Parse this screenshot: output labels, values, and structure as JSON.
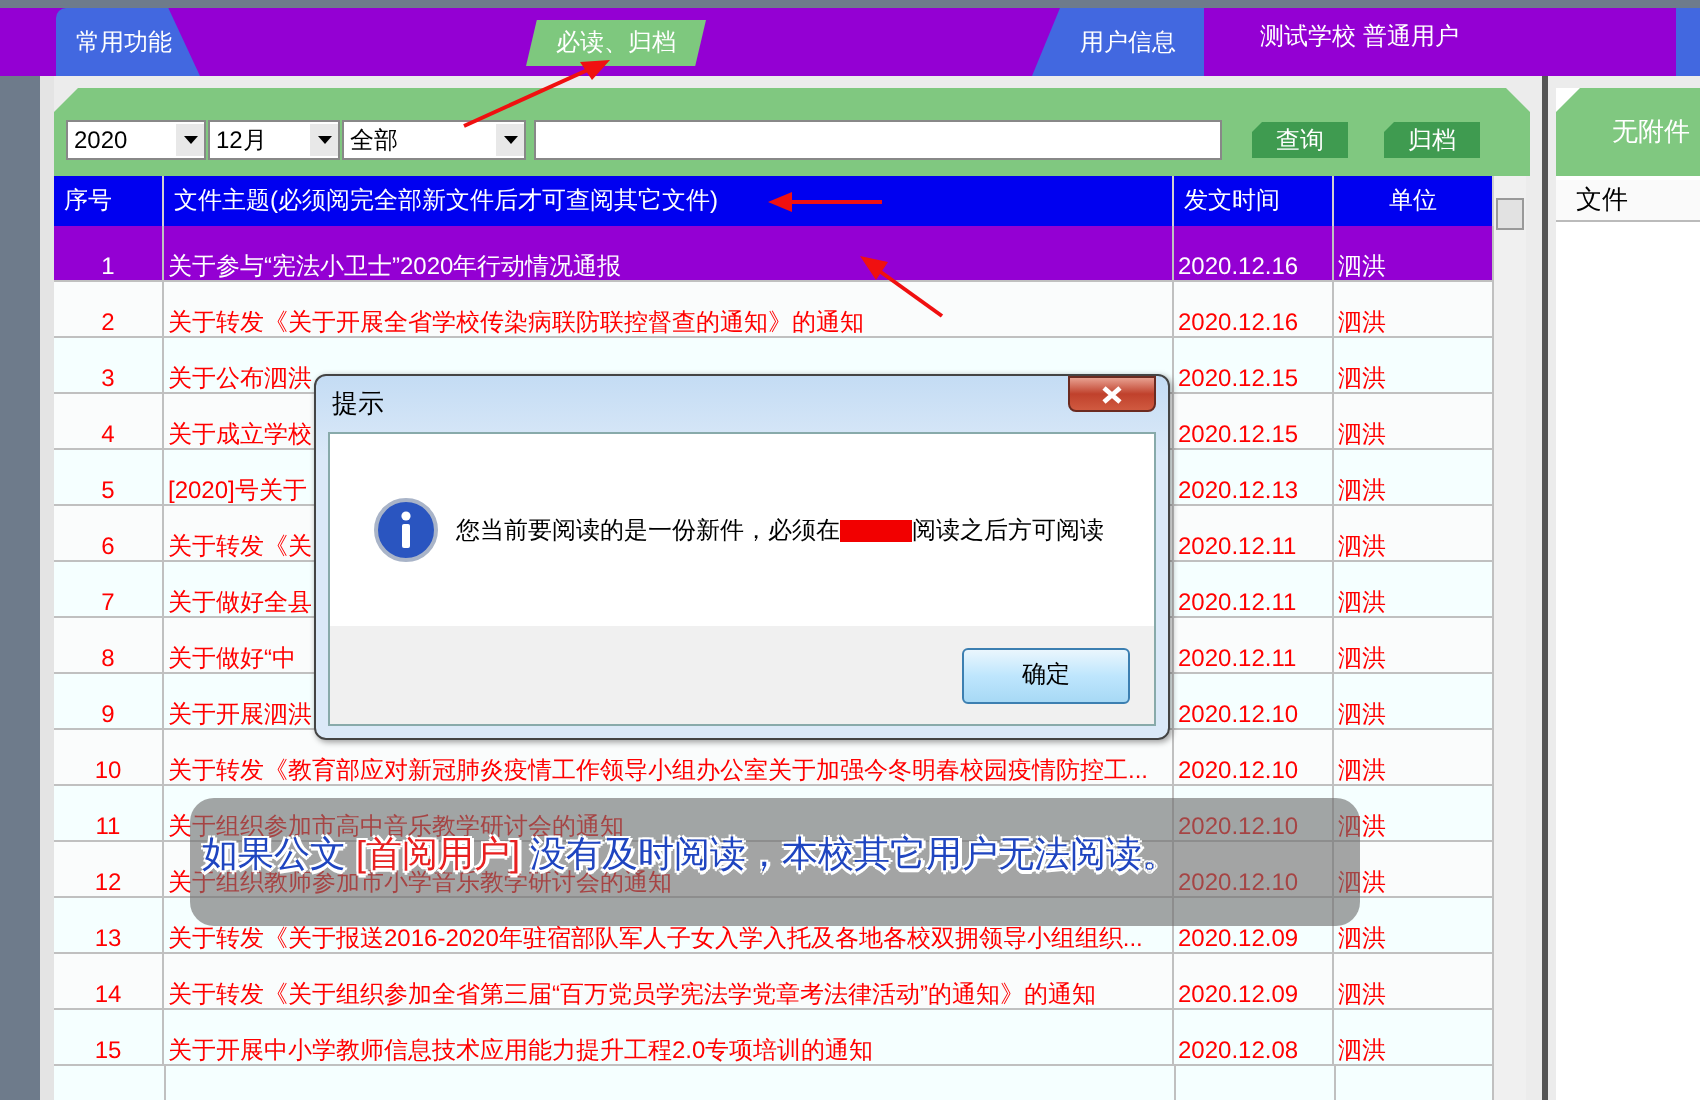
{
  "top_bar": {
    "items": [
      {
        "label": "常用功能",
        "kind": "menu"
      },
      {
        "label": "必读、归档",
        "kind": "current"
      },
      {
        "label": "用户信息",
        "kind": "info"
      },
      {
        "label": "测试学校 普通用户",
        "kind": "user"
      }
    ]
  },
  "filters": [
    {
      "value": "2020"
    },
    {
      "value": "12月"
    },
    {
      "value": "全部"
    }
  ],
  "buttons": [
    {
      "label": "查询"
    },
    {
      "label": "归档"
    }
  ],
  "table": {
    "columns": [
      "序号",
      "文件主题(必须阅完全部新文件后才可查阅其它文件)",
      "发文时间",
      "单位"
    ],
    "rows": [
      {
        "cells": [
          "1",
          "关于参与“宪法小卫士”2020年行动情况通报",
          "2020.12.16",
          "泗洪"
        ],
        "selected": true
      },
      {
        "cells": [
          "2",
          "关于转发《关于开展全省学校传染病联防联控督查的通知》的通知",
          "2020.12.16",
          "泗洪"
        ],
        "selected": false
      },
      {
        "cells": [
          "3",
          "关于公布泗洪",
          "2020.12.15",
          "泗洪"
        ],
        "selected": false
      },
      {
        "cells": [
          "4",
          "关于成立学校",
          "2020.12.15",
          "泗洪"
        ],
        "selected": false
      },
      {
        "cells": [
          "5",
          "[2020]号关于",
          "2020.12.13",
          "泗洪"
        ],
        "selected": false
      },
      {
        "cells": [
          "6",
          "关于转发《关",
          "2020.12.11",
          "泗洪"
        ],
        "selected": false
      },
      {
        "cells": [
          "7",
          "关于做好全县",
          "2020.12.11",
          "泗洪"
        ],
        "selected": false
      },
      {
        "cells": [
          "8",
          "关于做好“中",
          "2020.12.11",
          "泗洪"
        ],
        "selected": false
      },
      {
        "cells": [
          "9",
          "关于开展泗洪",
          "2020.12.10",
          "泗洪"
        ],
        "selected": false
      },
      {
        "cells": [
          "10",
          "关于转发《教育部应对新冠肺炎疫情工作领导小组办公室关于加强今冬明春校园疫情防控工...",
          "2020.12.10",
          "泗洪"
        ],
        "selected": false
      },
      {
        "cells": [
          "11",
          "关于组织参加市高中音乐教学研讨会的通知",
          "2020.12.10",
          "泗洪"
        ],
        "selected": false
      },
      {
        "cells": [
          "12",
          "关于组织教师参加市小学音乐教学研讨会的通知",
          "2020.12.10",
          "泗洪"
        ],
        "selected": false
      },
      {
        "cells": [
          "13",
          "关于转发《关于报送2016-2020年驻宿部队军人子女入学入托及各地各校双拥领导小组组织...",
          "2020.12.09",
          "泗洪"
        ],
        "selected": false
      },
      {
        "cells": [
          "14",
          "关于转发《关于组织参加全省第三届“百万党员学宪法学党章考法律活动”的通知》的通知",
          "2020.12.09",
          "泗洪"
        ],
        "selected": false
      },
      {
        "cells": [
          "15",
          "关于开展中小学教师信息技术应用能力提升工程2.0专项培训的通知",
          "2020.12.08",
          "泗洪"
        ],
        "selected": false
      }
    ]
  },
  "side_panel": {
    "title": "无附件",
    "columns": [
      "文件"
    ]
  },
  "dialog": {
    "title": "提示",
    "message_start": "您当前要阅读的是一份新件，必须在",
    "message_end": "阅读之后方可阅读",
    "button": "确定"
  },
  "caption": {
    "before": "如果公文 ",
    "highlight": "[首阅用户]",
    "after": " 没有及时阅读，本校其它用户无法阅读。"
  }
}
